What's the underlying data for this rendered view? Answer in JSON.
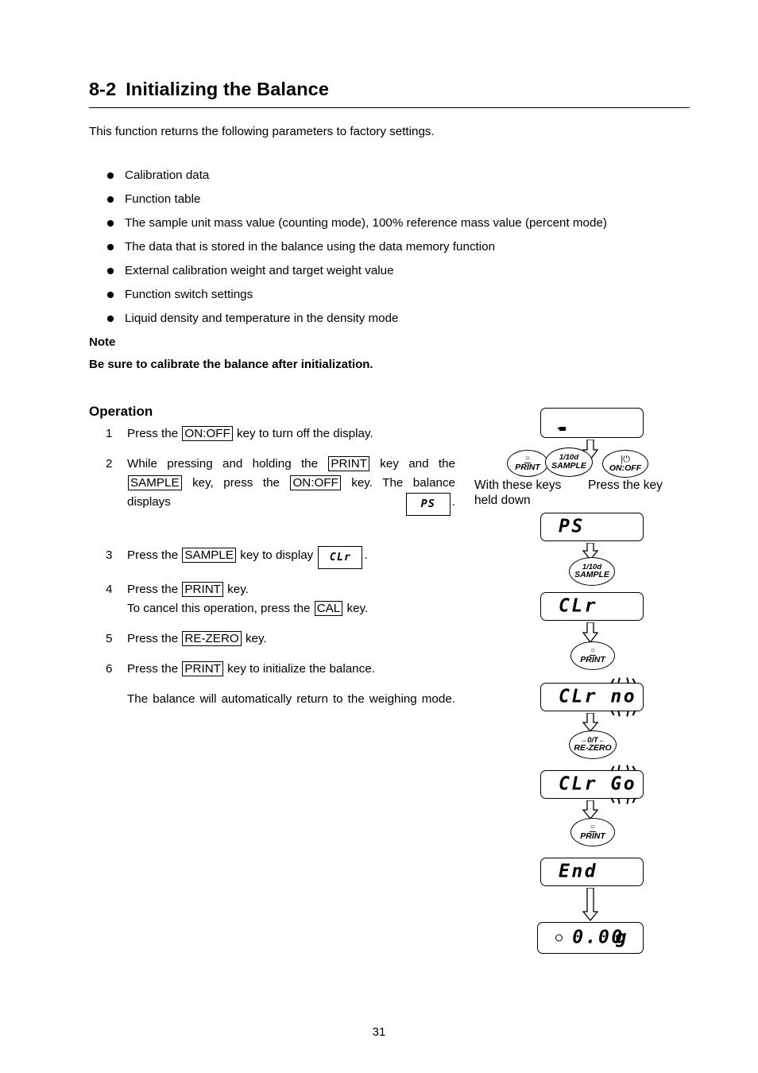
{
  "document": {
    "section_number": "8-2",
    "section_title": "Initializing the Balance",
    "intro": "This function returns the following parameters to factory settings.",
    "page_number": "31"
  },
  "parameters": [
    "Calibration data",
    "Function table",
    "The sample unit mass value (counting mode), 100% reference mass value (percent mode)",
    "The data that is stored in the balance using the data memory function",
    "External calibration weight and target weight value",
    "Function switch settings",
    "Liquid density and temperature in the density mode"
  ],
  "note": {
    "heading": "Note",
    "body": "Be sure to calibrate the balance after initialization."
  },
  "operation": {
    "heading": "Operation",
    "steps": [
      {
        "number": "1",
        "part1": "Press the ",
        "key1": "ON:OFF",
        "part2": " key to turn off the display."
      },
      {
        "number": "2",
        "part1": "While pressing and holding the ",
        "key1": "PRINT",
        "part2": " key and the ",
        "key2": "SAMPLE",
        "part3": " key, press the ",
        "key3": "ON:OFF",
        "part4": " key. The balance displays ",
        "display": "PS",
        "part5": "."
      },
      {
        "number": "3",
        "part1": "Press the ",
        "key1": "SAMPLE",
        "part2": " key to display ",
        "display": "CLr",
        "part3": "."
      },
      {
        "number": "4",
        "part1": "Press the ",
        "key1": "PRINT",
        "part2": " key.",
        "line2_part1": "To cancel this operation, press the ",
        "line2_key": "CAL",
        "line2_part2": " key."
      },
      {
        "number": "5",
        "part1": "Press the ",
        "key1": "RE-ZERO",
        "part2": " key."
      },
      {
        "number": "6",
        "part1": "Press the ",
        "key1": "PRINT",
        "part2": " key to initialize the balance.",
        "line2_part1": "The balance will automatically return to the weighing mode."
      }
    ]
  },
  "diagram": {
    "labels": {
      "hold_keys": "With these keys\nheld down",
      "press_key": "Press the key"
    },
    "keys": {
      "print": {
        "top_symbol": "○",
        "name": "PRINT"
      },
      "sample": {
        "top_symbol": "1/10d",
        "name": "SAMPLE"
      },
      "onoff": {
        "top_symbol": "|⏻",
        "name": "ON:OFF"
      },
      "rezero": {
        "top_symbol": "→0/T←",
        "name": "RE-ZERO"
      }
    },
    "displays": [
      {
        "id": "standby",
        "text": "",
        "blink": "",
        "unit": "",
        "stable": false
      },
      {
        "id": "ps",
        "text": "PS",
        "blink": "",
        "unit": "",
        "stable": false
      },
      {
        "id": "clr",
        "text": "CLr",
        "blink": "",
        "unit": "",
        "stable": false
      },
      {
        "id": "clr-no",
        "text": "CLr ",
        "blink": "no",
        "unit": "",
        "stable": false
      },
      {
        "id": "clr-go",
        "text": "CLr ",
        "blink": "Go",
        "unit": "",
        "stable": false
      },
      {
        "id": "end",
        "text": "End",
        "blink": "",
        "unit": "",
        "stable": false
      },
      {
        "id": "weighing",
        "text": "0.00",
        "blink": "",
        "unit": "g",
        "stable": true
      }
    ]
  },
  "colors": {
    "ink": "#000000",
    "paper": "#ffffff"
  }
}
